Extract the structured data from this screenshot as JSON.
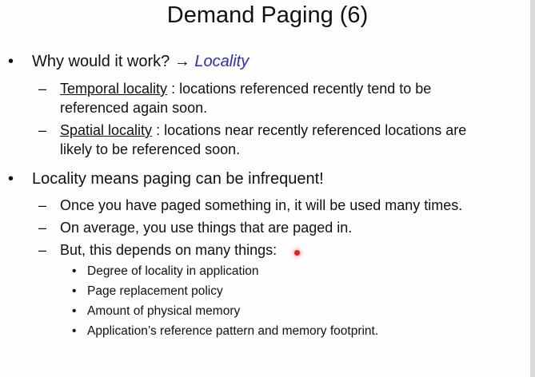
{
  "slide": {
    "title": "Demand Paging (6)",
    "items": [
      {
        "bullet": "•",
        "prefix": "Why would it work? → ",
        "emphasis": "Locality",
        "subitems": [
          {
            "dash": "–",
            "term": "Temporal locality",
            "text_line1": " : locations referenced recently tend to be",
            "text_line2": "referenced again soon."
          },
          {
            "dash": "–",
            "term": "Spatial locality",
            "text_line1": " :  locations near recently referenced locations are",
            "text_line2": "likely to be referenced soon."
          }
        ]
      },
      {
        "bullet": "•",
        "text": "Locality means paging can be infrequent!",
        "subitems": [
          {
            "dash": "–",
            "text": "Once you have paged something in, it will be used many times."
          },
          {
            "dash": "–",
            "text": "On average, you use things that are paged in."
          },
          {
            "dash": "–",
            "text": "But, this depends on many things:",
            "subitems": [
              {
                "dot": "•",
                "text": "Degree of locality in application"
              },
              {
                "dot": "•",
                "text": "Page replacement policy"
              },
              {
                "dot": "•",
                "text": "Amount of physical memory"
              },
              {
                "dot": "•",
                "text": "Application’s reference pattern and memory footprint."
              }
            ]
          }
        ]
      }
    ]
  },
  "colors": {
    "accent": "#2a2ad6",
    "pointer": "#e22020"
  }
}
